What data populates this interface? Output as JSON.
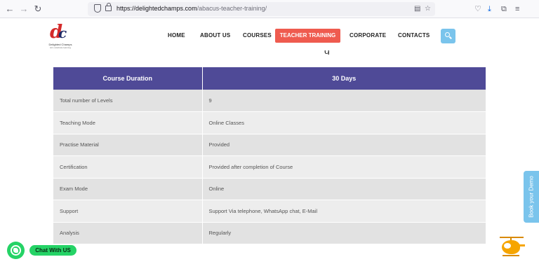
{
  "browser": {
    "back": "←",
    "forward": "→",
    "reload": "↻",
    "url_domain": "https://delightedchamps.com",
    "url_path": "/abacus-teacher-training/",
    "icons": [
      "shield-icon",
      "lock-icon",
      "reader-view-icon",
      "bookmark-star-icon",
      "pocket-icon",
      "download-icon",
      "extensions-icon",
      "menu-icon"
    ]
  },
  "site": {
    "logo_name": "Delighted Champs",
    "logo_tag": "let's celebrate learning",
    "menu": {
      "home": "HOME",
      "about": "ABOUT US",
      "courses": "COURSES",
      "teacher_training": "TEACHER TRAINING",
      "corporate": "CORPORATE",
      "contacts": "CONTACTS"
    }
  },
  "table": {
    "header": [
      "Course Duration",
      "30 Days"
    ],
    "rows": [
      [
        "Total number of Levels",
        "9"
      ],
      [
        "Teaching Mode",
        "Online Classes"
      ],
      [
        "Practise Material",
        "Provided"
      ],
      [
        "Certification",
        "Provided after completion of Course"
      ],
      [
        "Exam Mode",
        "Online"
      ],
      [
        "Support",
        "Support Via telephone, WhatsApp chat, E-Mail"
      ],
      [
        "Analysis",
        "Regularly"
      ]
    ]
  },
  "side_tab": "Book your Demo",
  "whatsapp": {
    "label": "Chat With US"
  },
  "colors": {
    "header": "#4f4a97",
    "active_menu": "#ef5b4f",
    "accent": "#7ac4ec",
    "whatsapp": "#25d366"
  }
}
